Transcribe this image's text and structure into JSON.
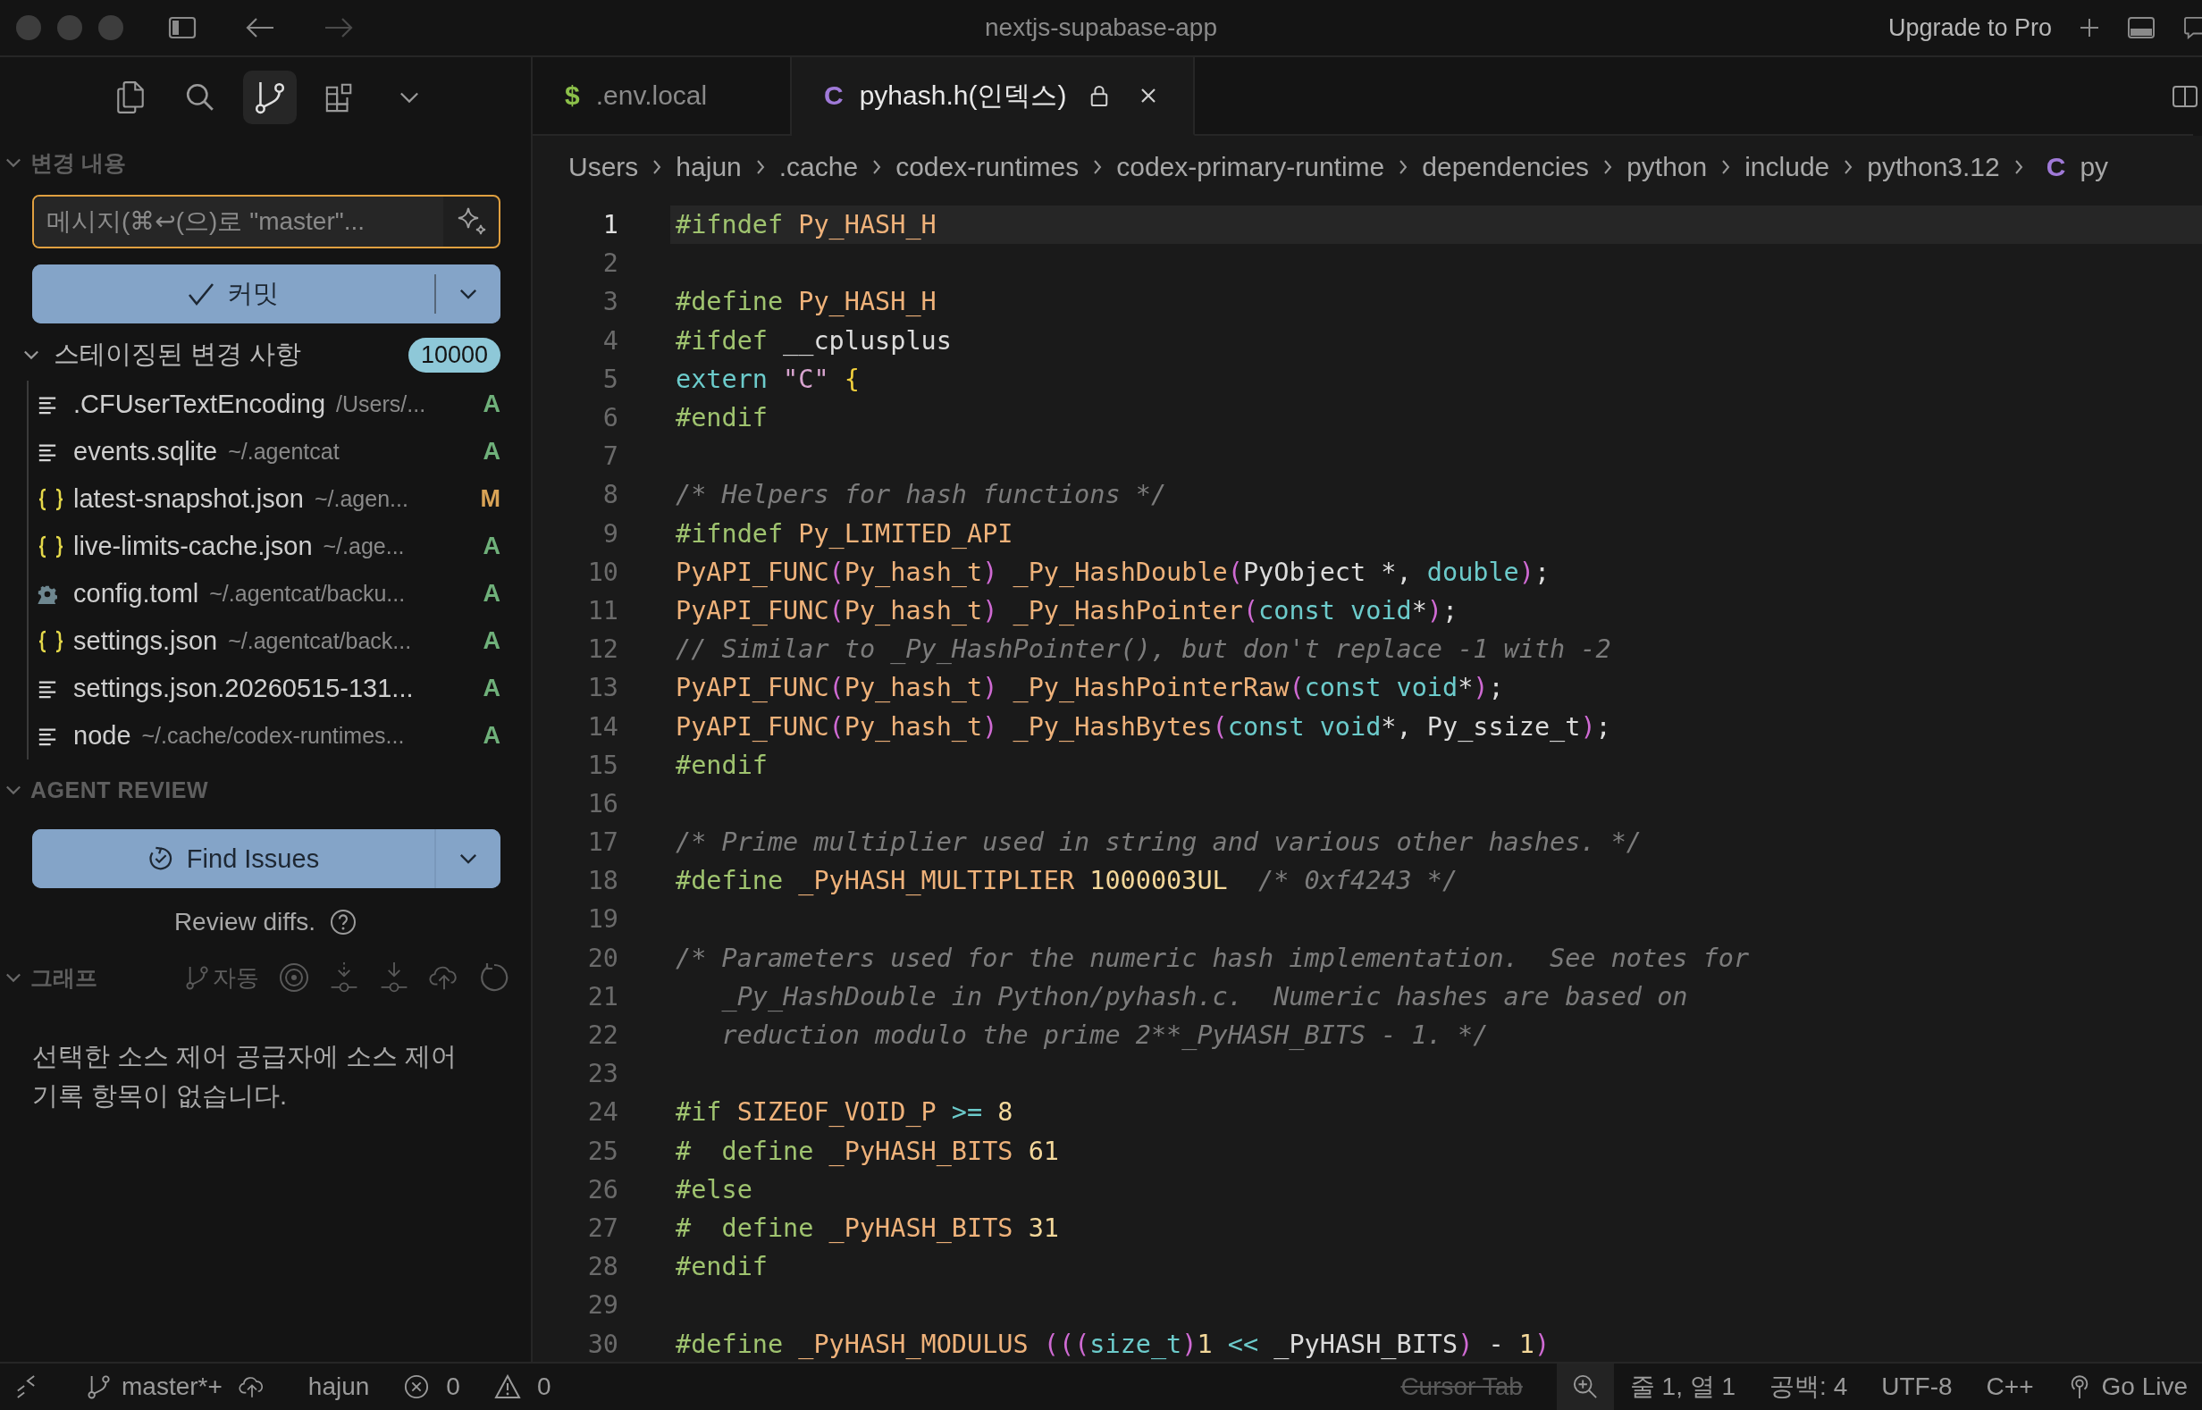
{
  "window": {
    "title": "nextjs-supabase-app",
    "upgrade": "Upgrade to Pro"
  },
  "activity_bar": [
    {
      "kind": "files",
      "selected": false
    },
    {
      "kind": "search",
      "selected": false
    },
    {
      "kind": "source-control",
      "selected": true
    },
    {
      "kind": "extensions",
      "selected": false
    },
    {
      "kind": "more",
      "selected": false
    }
  ],
  "changes": {
    "title": "변경 내용",
    "expanded": true,
    "message": {
      "placeholder": "메시지(⌘↩(으)로 \"master\"..."
    },
    "commit": "커밋",
    "staged": {
      "title": "스테이징된 변경 사항",
      "expanded": true,
      "count": "10000",
      "files": [
        {
          "kind": "text",
          "name": ".CFUserTextEncoding",
          "path": "/Users/...",
          "status": "A",
          "color": "#6fb07a"
        },
        {
          "kind": "text",
          "name": "events.sqlite",
          "path": "~/.agentcat",
          "status": "A",
          "color": "#6fb07a"
        },
        {
          "kind": "json",
          "name": "latest-snapshot.json",
          "path": "~/.agen...",
          "status": "M",
          "color": "#d9a356"
        },
        {
          "kind": "json",
          "name": "live-limits-cache.json",
          "path": "~/.age...",
          "status": "A",
          "color": "#6fb07a"
        },
        {
          "kind": "config",
          "name": "config.toml",
          "path": "~/.agentcat/backu...",
          "status": "A",
          "color": "#6fb07a"
        },
        {
          "kind": "json",
          "name": "settings.json",
          "path": "~/.agentcat/back...",
          "status": "A",
          "color": "#6fb07a"
        },
        {
          "kind": "text",
          "name": "settings.json.20260515-131...",
          "status": "A",
          "color": "#6fb07a"
        },
        {
          "kind": "text",
          "name": "node",
          "path": "~/.cache/codex-runtimes...",
          "status": "A",
          "color": "#6fb07a"
        }
      ]
    }
  },
  "agent_review": {
    "title": "AGENT REVIEW",
    "expanded": true,
    "button": "Find Issues",
    "hint": "Review diffs."
  },
  "graph": {
    "title": "그래프",
    "expanded": true,
    "auto": "자동",
    "empty": "선택한 소스 제어 공급자에 소스 제어 기록 항목이 없습니다."
  },
  "tabs": [
    {
      "icon": "$",
      "label": ".env.local",
      "selected": false,
      "locked": false
    },
    {
      "icon": "C",
      "label": "pyhash.h(인덱스)",
      "selected": true,
      "locked": true
    }
  ],
  "breadcrumb": [
    "Users",
    "hajun",
    ".cache",
    "codex-runtimes",
    "codex-primary-runtime",
    "dependencies",
    "python",
    "include",
    "python3.12"
  ],
  "breadcrumb_file": {
    "icon": "C",
    "label": "py"
  },
  "editor": {
    "lines": [
      {
        "number": "1",
        "current": true,
        "tokens": [
          {
            "text": "#ifndef ",
            "kind": "dir"
          },
          {
            "text": "Py_HASH_H",
            "kind": "mac"
          }
        ]
      },
      {
        "number": "2",
        "current": false
      },
      {
        "number": "3",
        "current": false,
        "tokens": [
          {
            "text": "#define ",
            "kind": "dir"
          },
          {
            "text": "Py_HASH_H",
            "kind": "mac"
          }
        ]
      },
      {
        "number": "4",
        "current": false,
        "tokens": [
          {
            "text": "#ifdef ",
            "kind": "dir"
          },
          {
            "text": "__cplusplus",
            "kind": "plain"
          }
        ]
      },
      {
        "number": "5",
        "current": false,
        "tokens": [
          {
            "text": "extern ",
            "kind": "kw"
          },
          {
            "text": "\"C\" ",
            "kind": "str"
          },
          {
            "text": "{",
            "kind": "brace"
          }
        ]
      },
      {
        "number": "6",
        "current": false,
        "tokens": [
          {
            "text": "#endif",
            "kind": "dir"
          }
        ]
      },
      {
        "number": "7",
        "current": false
      },
      {
        "number": "8",
        "current": false,
        "tokens": [
          {
            "text": "/* Helpers for hash functions */",
            "kind": "comment"
          }
        ]
      },
      {
        "number": "9",
        "current": false,
        "tokens": [
          {
            "text": "#ifndef ",
            "kind": "dir"
          },
          {
            "text": "Py_LIMITED_API",
            "kind": "mac"
          }
        ]
      },
      {
        "number": "10",
        "current": false,
        "tokens": [
          {
            "text": "PyAPI_FUNC",
            "kind": "mac"
          },
          {
            "text": "(",
            "kind": "paren"
          },
          {
            "text": "Py_hash_t",
            "kind": "mac"
          },
          {
            "text": ") ",
            "kind": "paren"
          },
          {
            "text": "_Py_HashDouble",
            "kind": "mac"
          },
          {
            "text": "(",
            "kind": "paren"
          },
          {
            "text": "PyObject *, ",
            "kind": "plain"
          },
          {
            "text": "double",
            "kind": "kw"
          },
          {
            "text": ")",
            "kind": "paren"
          },
          {
            "text": ";",
            "kind": "plain"
          }
        ]
      },
      {
        "number": "11",
        "current": false,
        "tokens": [
          {
            "text": "PyAPI_FUNC",
            "kind": "mac"
          },
          {
            "text": "(",
            "kind": "paren"
          },
          {
            "text": "Py_hash_t",
            "kind": "mac"
          },
          {
            "text": ") ",
            "kind": "paren"
          },
          {
            "text": "_Py_HashPointer",
            "kind": "mac"
          },
          {
            "text": "(",
            "kind": "paren"
          },
          {
            "text": "const void",
            "kind": "kw"
          },
          {
            "text": "*",
            "kind": "plain"
          },
          {
            "text": ")",
            "kind": "paren"
          },
          {
            "text": ";",
            "kind": "plain"
          }
        ]
      },
      {
        "number": "12",
        "current": false,
        "tokens": [
          {
            "text": "// Similar to _Py_HashPointer(), but don't replace -1 with -2",
            "kind": "comment"
          }
        ]
      },
      {
        "number": "13",
        "current": false,
        "tokens": [
          {
            "text": "PyAPI_FUNC",
            "kind": "mac"
          },
          {
            "text": "(",
            "kind": "paren"
          },
          {
            "text": "Py_hash_t",
            "kind": "mac"
          },
          {
            "text": ") ",
            "kind": "paren"
          },
          {
            "text": "_Py_HashPointerRaw",
            "kind": "mac"
          },
          {
            "text": "(",
            "kind": "paren"
          },
          {
            "text": "const void",
            "kind": "kw"
          },
          {
            "text": "*",
            "kind": "plain"
          },
          {
            "text": ")",
            "kind": "paren"
          },
          {
            "text": ";",
            "kind": "plain"
          }
        ]
      },
      {
        "number": "14",
        "current": false,
        "tokens": [
          {
            "text": "PyAPI_FUNC",
            "kind": "mac"
          },
          {
            "text": "(",
            "kind": "paren"
          },
          {
            "text": "Py_hash_t",
            "kind": "mac"
          },
          {
            "text": ") ",
            "kind": "paren"
          },
          {
            "text": "_Py_HashBytes",
            "kind": "mac"
          },
          {
            "text": "(",
            "kind": "paren"
          },
          {
            "text": "const void",
            "kind": "kw"
          },
          {
            "text": "*, Py_ssize_t",
            "kind": "plain"
          },
          {
            "text": ")",
            "kind": "paren"
          },
          {
            "text": ";",
            "kind": "plain"
          }
        ]
      },
      {
        "number": "15",
        "current": false,
        "tokens": [
          {
            "text": "#endif",
            "kind": "dir"
          }
        ]
      },
      {
        "number": "16",
        "current": false
      },
      {
        "number": "17",
        "current": false,
        "tokens": [
          {
            "text": "/* Prime multiplier used in string and various other hashes. */",
            "kind": "comment"
          }
        ]
      },
      {
        "number": "18",
        "current": false,
        "tokens": [
          {
            "text": "#define ",
            "kind": "dir"
          },
          {
            "text": "_PyHASH_MULTIPLIER ",
            "kind": "mac"
          },
          {
            "text": "1000003UL  ",
            "kind": "num"
          },
          {
            "text": "/* 0xf4243 */",
            "kind": "comment"
          }
        ]
      },
      {
        "number": "19",
        "current": false
      },
      {
        "number": "20",
        "current": false,
        "tokens": [
          {
            "text": "/* Parameters used for the numeric hash implementation.  See notes for",
            "kind": "comment"
          }
        ]
      },
      {
        "number": "21",
        "current": false,
        "tokens": [
          {
            "text": "   _Py_HashDouble in Python/pyhash.c.  Numeric hashes are based on",
            "kind": "comment"
          }
        ]
      },
      {
        "number": "22",
        "current": false,
        "tokens": [
          {
            "text": "   reduction modulo the prime 2**_PyHASH_BITS - 1. */",
            "kind": "comment"
          }
        ]
      },
      {
        "number": "23",
        "current": false
      },
      {
        "number": "24",
        "current": false,
        "tokens": [
          {
            "text": "#if ",
            "kind": "dir"
          },
          {
            "text": "SIZEOF_VOID_P ",
            "kind": "mac"
          },
          {
            "text": ">= ",
            "kind": "kw"
          },
          {
            "text": "8",
            "kind": "num"
          }
        ]
      },
      {
        "number": "25",
        "current": false,
        "tokens": [
          {
            "text": "#  define ",
            "kind": "dir"
          },
          {
            "text": "_PyHASH_BITS ",
            "kind": "mac"
          },
          {
            "text": "61",
            "kind": "num"
          }
        ]
      },
      {
        "number": "26",
        "current": false,
        "tokens": [
          {
            "text": "#else",
            "kind": "dir"
          }
        ]
      },
      {
        "number": "27",
        "current": false,
        "tokens": [
          {
            "text": "#  define ",
            "kind": "dir"
          },
          {
            "text": "_PyHASH_BITS ",
            "kind": "mac"
          },
          {
            "text": "31",
            "kind": "num"
          }
        ]
      },
      {
        "number": "28",
        "current": false,
        "tokens": [
          {
            "text": "#endif",
            "kind": "dir"
          }
        ]
      },
      {
        "number": "29",
        "current": false
      },
      {
        "number": "30",
        "current": false,
        "tokens": [
          {
            "text": "#define ",
            "kind": "dir"
          },
          {
            "text": "_PyHASH_MODULUS ",
            "kind": "mac"
          },
          {
            "text": "(((",
            "kind": "paren"
          },
          {
            "text": "size_t",
            "kind": "kw"
          },
          {
            "text": ")",
            "kind": "paren"
          },
          {
            "text": "1 ",
            "kind": "num"
          },
          {
            "text": "<<",
            "kind": "kw"
          },
          {
            "text": " _PyHASH_BITS",
            "kind": "plain"
          },
          {
            "text": ")",
            "kind": "paren"
          },
          {
            "text": " - ",
            "kind": "plain"
          },
          {
            "text": "1",
            "kind": "num"
          },
          {
            "text": ")",
            "kind": "paren"
          }
        ]
      }
    ]
  },
  "status_bar": {
    "branch": "master*+",
    "user": "hajun",
    "errors": "0",
    "warnings": "0",
    "cursor_tab": {
      "label": "Cursor Tab",
      "disabled": true
    },
    "position": "줄 1, 열 1",
    "spaces": "공백: 4",
    "encoding": "UTF-8",
    "language": "C++",
    "live": "Go Live"
  }
}
